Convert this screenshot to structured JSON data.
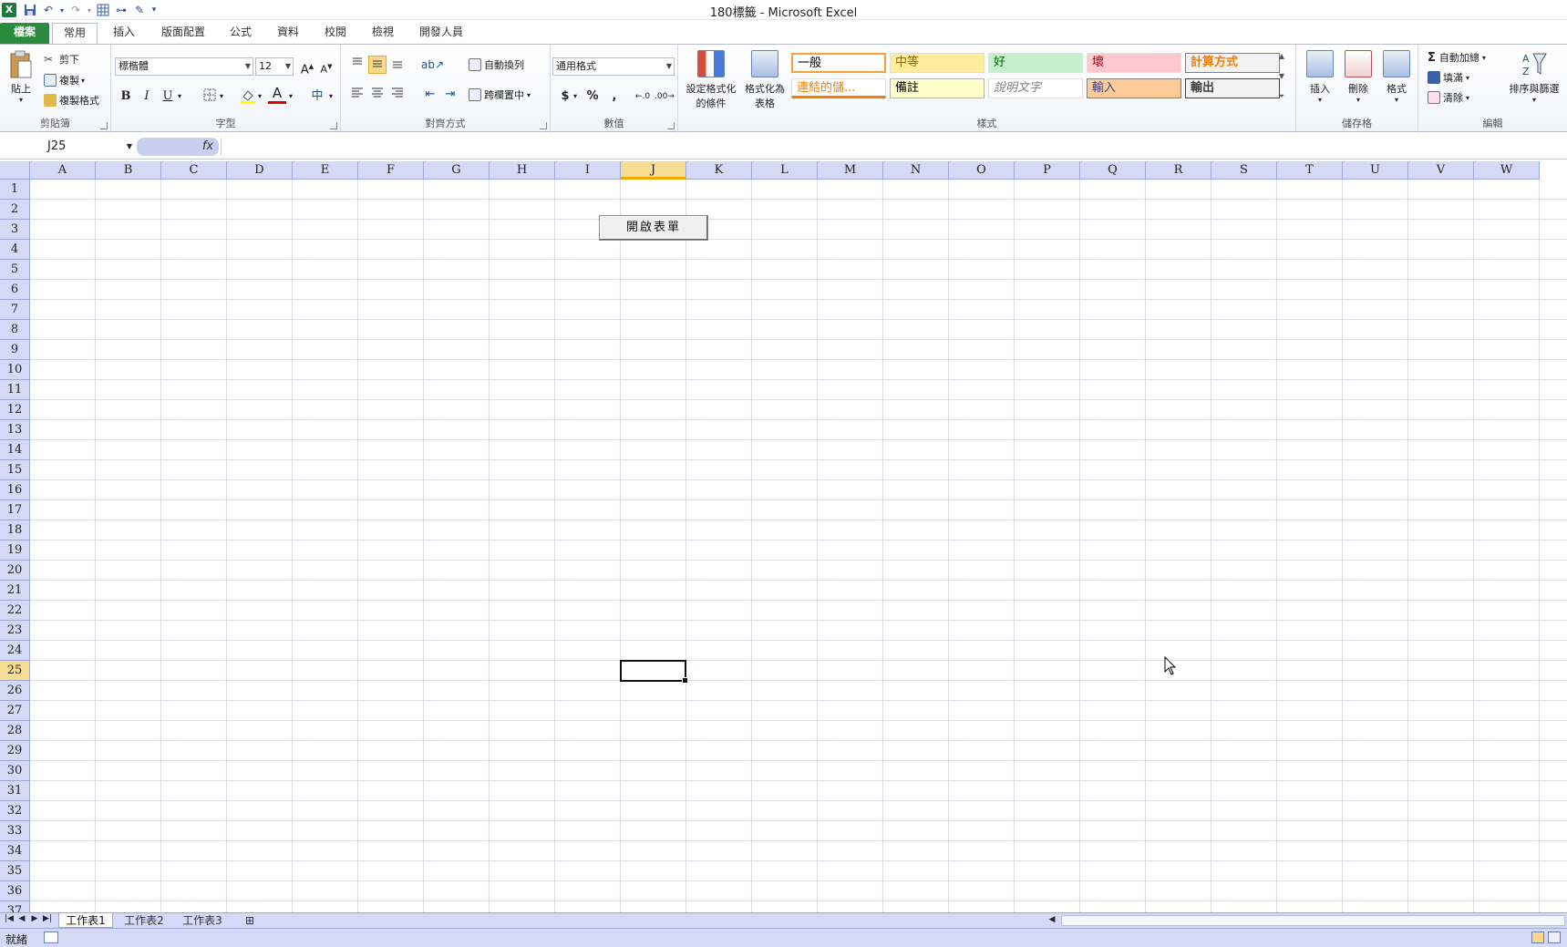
{
  "window": {
    "title": "180標籤 - Microsoft Excel"
  },
  "qat": {
    "logo": "X"
  },
  "tabs": [
    {
      "label": "檔案",
      "kind": "file"
    },
    {
      "label": "常用",
      "kind": "active"
    },
    {
      "label": "插入"
    },
    {
      "label": "版面配置"
    },
    {
      "label": "公式"
    },
    {
      "label": "資料"
    },
    {
      "label": "校閱"
    },
    {
      "label": "檢視"
    },
    {
      "label": "開發人員"
    }
  ],
  "ribbon": {
    "clipboard": {
      "label": "剪貼簿",
      "paste": "貼上",
      "cut": "剪下",
      "copy": "複製",
      "format_painter": "複製格式"
    },
    "font": {
      "label": "字型",
      "name": "標楷體",
      "size": "12",
      "bold": "B",
      "italic": "I",
      "underline": "U"
    },
    "alignment": {
      "label": "對齊方式",
      "wrap": "自動換列",
      "merge": "跨欄置中"
    },
    "number": {
      "label": "數值",
      "format": "通用格式",
      "currency": "$",
      "percent": "%",
      "comma": ","
    },
    "styles": {
      "label": "樣式",
      "conditional": "設定格式化的條件",
      "cond_line1": "設定格式化",
      "cond_line2": "的條件",
      "table_line1": "格式化為",
      "table_line2": "表格",
      "cells": [
        {
          "label": "一般",
          "bg": "#ffffff",
          "fg": "#000000",
          "border": "#f2a33a"
        },
        {
          "label": "中等",
          "bg": "#ffeb9c",
          "fg": "#9c6500"
        },
        {
          "label": "好",
          "bg": "#c6efce",
          "fg": "#006100"
        },
        {
          "label": "壞",
          "bg": "#ffc7ce",
          "fg": "#9c0006"
        },
        {
          "label": "計算方式",
          "bg": "#f2f2f2",
          "fg": "#fa7d00",
          "border": "#7f7f7f"
        },
        {
          "label": "連結的儲...",
          "bg": "#ffffff",
          "fg": "#fa7d00"
        },
        {
          "label": "備註",
          "bg": "#ffffcc",
          "fg": "#000000",
          "border": "#b2b2b2"
        },
        {
          "label": "說明文字",
          "bg": "#ffffff",
          "fg": "#7f7f7f"
        },
        {
          "label": "輸入",
          "bg": "#ffcc99",
          "fg": "#3f3f76",
          "border": "#7f7f7f"
        },
        {
          "label": "輸出",
          "bg": "#f2f2f2",
          "fg": "#3f3f3f",
          "border": "#3f3f3f"
        }
      ]
    },
    "cells": {
      "label": "儲存格",
      "insert": "插入",
      "delete": "刪除",
      "format": "格式"
    },
    "editing": {
      "label": "編輯",
      "autosum": "自動加總",
      "fill": "填滿",
      "clear": "清除",
      "sort": "排序與篩選"
    }
  },
  "formula_bar": {
    "name_box": "J25",
    "fx": "fx",
    "value": ""
  },
  "grid": {
    "columns": [
      "A",
      "B",
      "C",
      "D",
      "E",
      "F",
      "G",
      "H",
      "I",
      "J",
      "K",
      "L",
      "M",
      "N",
      "O",
      "P",
      "Q",
      "R",
      "S",
      "T",
      "U",
      "V",
      "W"
    ],
    "rows": [
      "1",
      "2",
      "3",
      "4",
      "5",
      "6",
      "7",
      "8",
      "9",
      "10",
      "11",
      "12",
      "13",
      "14",
      "15",
      "16",
      "17",
      "18",
      "19",
      "20",
      "21",
      "22",
      "23",
      "24",
      "25",
      "26",
      "27",
      "28",
      "29",
      "30",
      "31",
      "32",
      "33",
      "34",
      "35",
      "36",
      "37"
    ],
    "selected_column": "J",
    "selected_row": "25",
    "form_button": "開啟表單"
  },
  "sheets": [
    {
      "label": "工作表1",
      "active": true
    },
    {
      "label": "工作表2"
    },
    {
      "label": "工作表3"
    }
  ],
  "status": {
    "text": "就緒"
  }
}
